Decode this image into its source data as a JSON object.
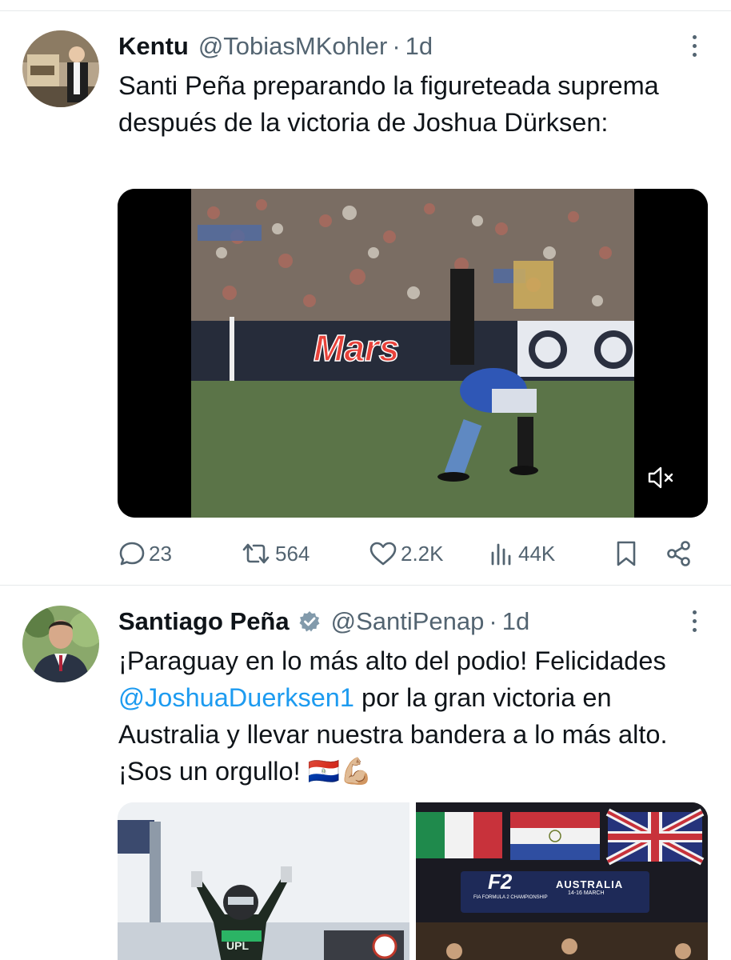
{
  "tweets": [
    {
      "name": "Kentu",
      "handle": "@TobiasMKohler",
      "separator": "·",
      "time": "1d",
      "text": "Santi Peña preparando la figureteada suprema después de la victoria de Joshua Dürksen:",
      "video_billboard_text": "Mars",
      "actions": {
        "replies": "23",
        "reposts": "564",
        "likes": "2.2K",
        "views": "44K"
      }
    },
    {
      "name": "Santiago Peña",
      "handle": "@SantiPenap",
      "separator": "·",
      "time": "1d",
      "text_before": "¡Paraguay en lo más alto del podio! Felicidades ",
      "mention": "@JoshuaDuerksen1",
      "text_after": " por la gran victoria en Australia y llevar nuestra bandera a lo más alto. ¡Sos un orgullo! 🇵🇾💪🏼",
      "media_right": {
        "logo": "F2",
        "logo_sub": "FIA FORMULA 2 CHAMPIONSHIP",
        "board_title": "AUSTRALIA",
        "board_dates": "14-16 MARCH"
      }
    }
  ],
  "colors": {
    "text": "#0f1419",
    "muted": "#536471",
    "link": "#1d9bf0",
    "divider": "#e6e9eb",
    "verified": "#829aab"
  },
  "icons": [
    "more-icon",
    "reply-icon",
    "repost-icon",
    "like-icon",
    "views-icon",
    "bookmark-icon",
    "share-icon",
    "mute-icon",
    "verified-badge-icon"
  ]
}
